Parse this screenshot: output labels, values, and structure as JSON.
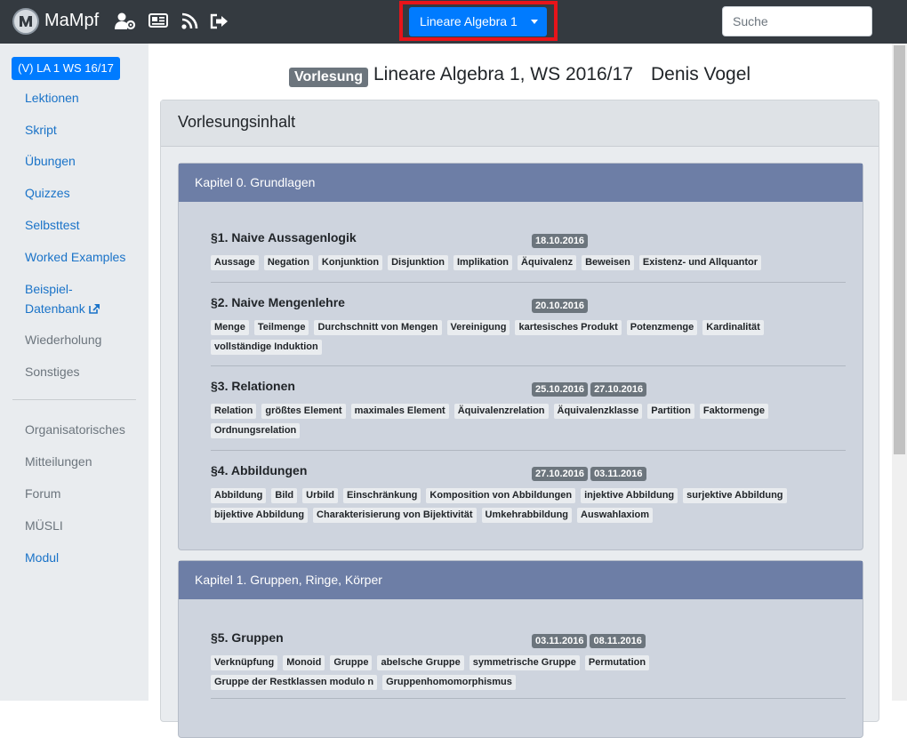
{
  "app": {
    "brand": "MaMpf",
    "icons": [
      "user-gear-icon",
      "newspaper-icon",
      "rss-icon",
      "sign-out-icon"
    ],
    "course_dropdown": "Lineare Algebra 1",
    "search_placeholder": "Suche",
    "colors": {
      "topbar": "#343a40",
      "primary": "#007bff",
      "highlight": "#e8141a",
      "chapter_header": "#6d7ea6"
    }
  },
  "sidebar": {
    "course_badge": "(V) LA 1 WS 16/17",
    "items": [
      {
        "label": "Lektionen"
      },
      {
        "label": "Skript"
      },
      {
        "label": "Übungen"
      },
      {
        "label": "Quizzes"
      },
      {
        "label": "Selbsttest"
      },
      {
        "label": "Worked Examples"
      },
      {
        "label": "Beispiel-"
      },
      {
        "label": "Datenbank"
      },
      {
        "label": "Wiederholung"
      },
      {
        "label": "Sonstiges"
      }
    ],
    "items2": [
      {
        "label": "Organisatorisches"
      },
      {
        "label": "Mitteilungen"
      },
      {
        "label": "Forum"
      },
      {
        "label": "MÜSLI"
      },
      {
        "label": "Modul"
      }
    ]
  },
  "header": {
    "badge": "Vorlesung",
    "title": "Lineare Algebra 1, WS 2016/17",
    "lecturer": "Denis Vogel"
  },
  "content": {
    "card_title": "Vorlesungsinhalt",
    "chapters": [
      {
        "title": "Kapitel 0. Grundlagen",
        "sections": [
          {
            "title": "§1. Naive Aussagenlogik",
            "dates": [
              "18.10.2016"
            ],
            "tags": [
              "Aussage",
              "Negation",
              "Konjunktion",
              "Disjunktion",
              "Implikation",
              "Äquivalenz",
              "Beweisen",
              "Existenz- und Allquantor"
            ]
          },
          {
            "title": "§2. Naive Mengenlehre",
            "dates": [
              "20.10.2016"
            ],
            "tags": [
              "Menge",
              "Teilmenge",
              "Durchschnitt von Mengen",
              "Vereinigung",
              "kartesisches Produkt",
              "Potenzmenge",
              "Kardinalität",
              "vollständige Induktion"
            ]
          },
          {
            "title": "§3. Relationen",
            "dates": [
              "25.10.2016",
              "27.10.2016"
            ],
            "tags": [
              "Relation",
              "größtes Element",
              "maximales Element",
              "Äquivalenzrelation",
              "Äquivalenzklasse",
              "Partition",
              "Faktormenge",
              "Ordnungsrelation"
            ]
          },
          {
            "title": "§4. Abbildungen",
            "dates": [
              "27.10.2016",
              "03.11.2016"
            ],
            "tags": [
              "Abbildung",
              "Bild",
              "Urbild",
              "Einschränkung",
              "Komposition von Abbildungen",
              "injektive Abbildung",
              "surjektive Abbildung",
              "bijektive Abbildung",
              "Charakterisierung von Bijektivität",
              "Umkehrabbildung",
              "Auswahlaxiom"
            ]
          }
        ]
      },
      {
        "title": "Kapitel 1. Gruppen, Ringe, Körper",
        "sections": [
          {
            "title": "§5. Gruppen",
            "dates": [
              "03.11.2016",
              "08.11.2016"
            ],
            "tags": [
              "Verknüpfung",
              "Monoid",
              "Gruppe",
              "abelsche Gruppe",
              "symmetrische Gruppe",
              "Permutation",
              "Gruppe der Restklassen modulo n",
              "Gruppenhomomorphismus"
            ]
          }
        ]
      }
    ]
  }
}
